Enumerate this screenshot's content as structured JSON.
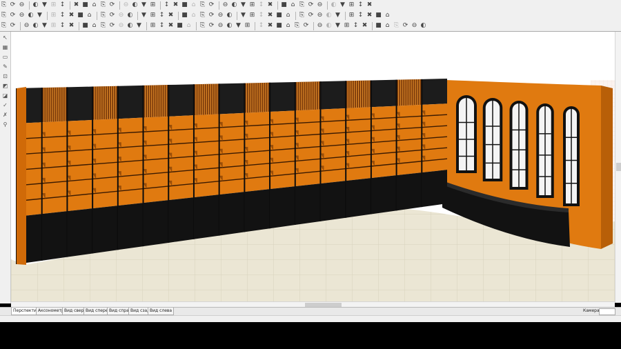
{
  "toolbars": {
    "row1_count": 38,
    "row2_count": 40,
    "row3_count": 44
  },
  "tabs": [
    "Перспектива",
    "Аксонометрия",
    "Вид сверху",
    "Вид спереди",
    "Вид справа",
    "Вид сзади",
    "Вид слева"
  ],
  "active_tab": "Перспектива",
  "camera": {
    "label": "Камера:"
  },
  "scene": {
    "wall_color": "#e07a10",
    "cabinet_base_color": "#121212",
    "cornice_color": "#1c1c1c",
    "floor_color": "#ebe6d4",
    "shelf_bays": 17,
    "arched_windows": 5
  },
  "colors": {
    "toolbar_bg": "#f0f0f0",
    "viewport_bg": "#ffffff"
  }
}
